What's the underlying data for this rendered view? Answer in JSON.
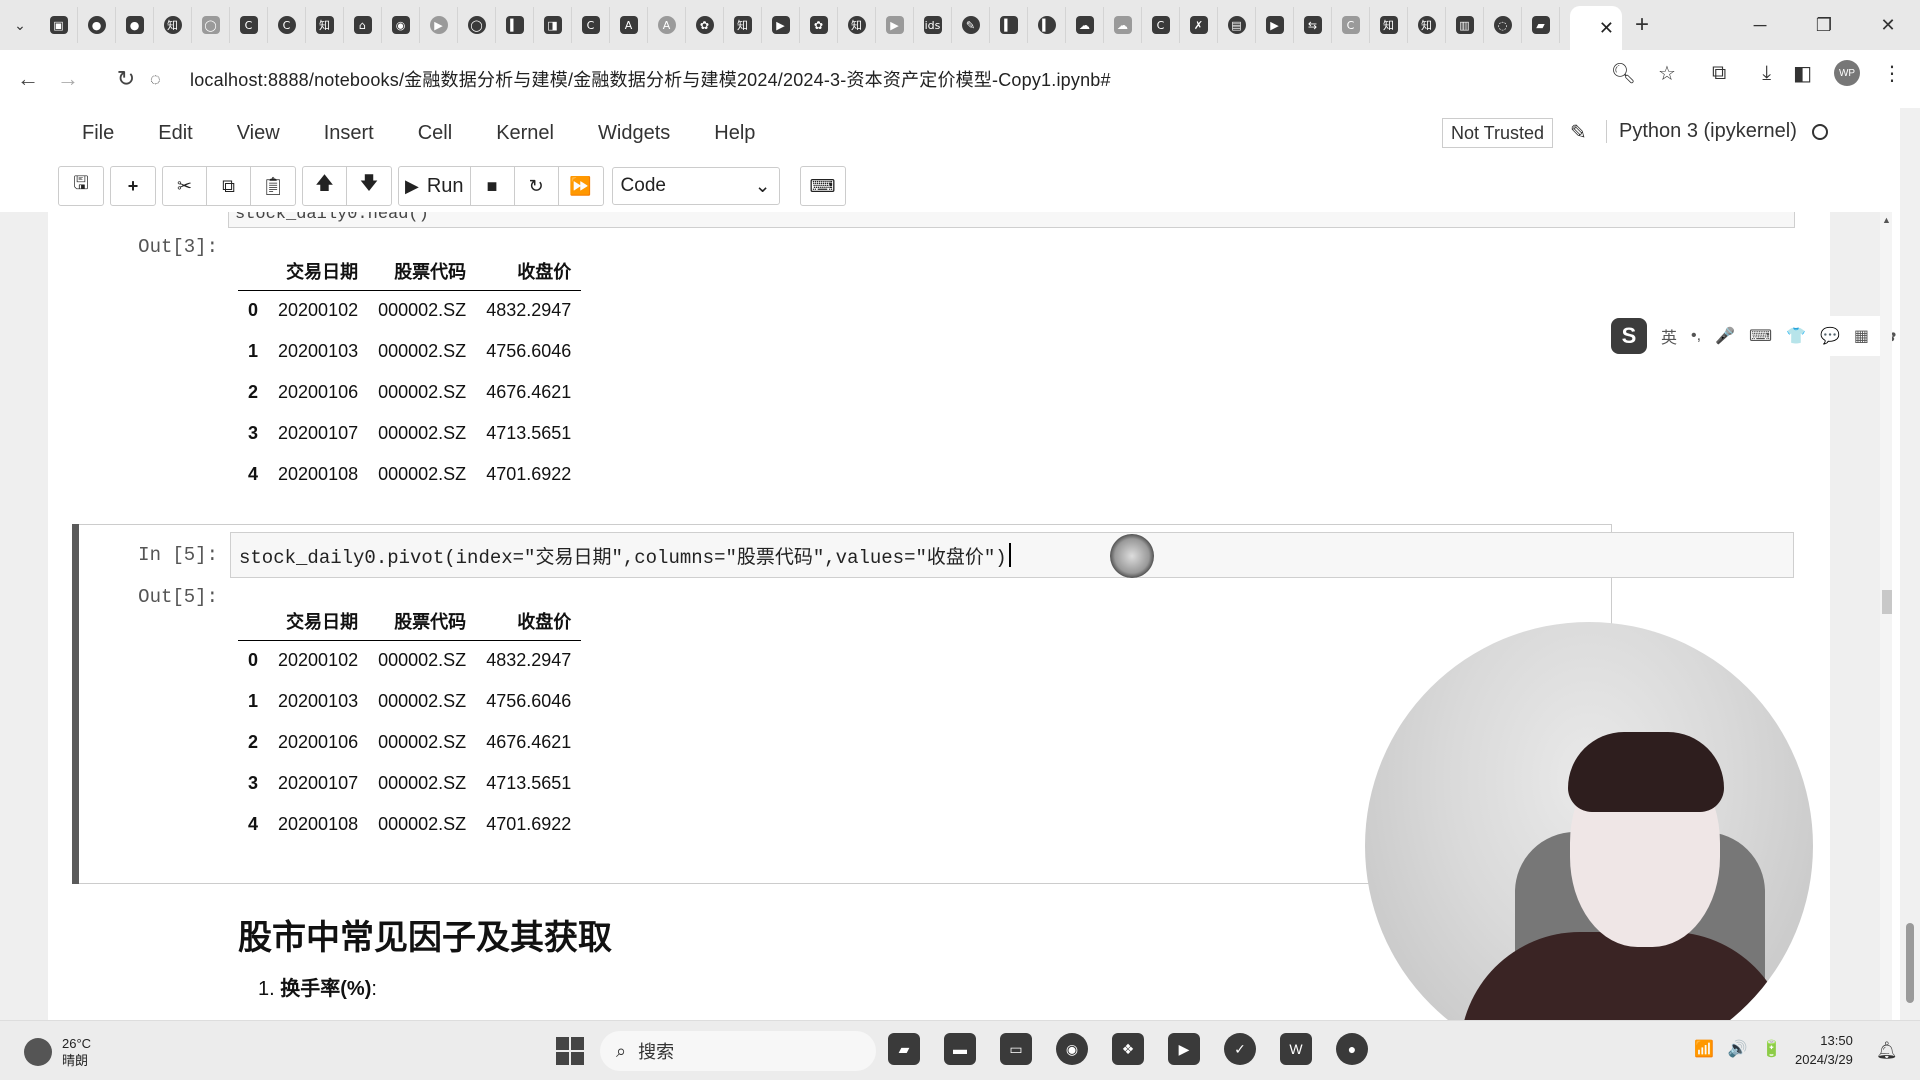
{
  "browser": {
    "tab_favicons": [
      "▣",
      "●",
      "●",
      "知",
      "◯",
      "C",
      "C",
      "知",
      "⌂",
      "◉",
      "▶",
      "◯",
      "▍",
      "◨",
      "C",
      "A",
      "A",
      "✿",
      "知",
      "▶",
      "✿",
      "知",
      "▶",
      "ids",
      "✎",
      "▍",
      "▍",
      "☁",
      "☁",
      "C",
      "✗",
      "▤",
      "▶",
      "⇆",
      "C",
      "知",
      "知",
      "▥",
      "◌",
      "▰"
    ],
    "active_tab_close": "✕",
    "new_tab": "+",
    "window_controls": [
      "─",
      "❐",
      "✕"
    ],
    "url": "localhost:8888/notebooks/金融数据分析与建模/金融数据分析与建模2024/2024-3-资本资产定价模型-Copy1.ipynb#"
  },
  "jupyter": {
    "menu": [
      "File",
      "Edit",
      "View",
      "Insert",
      "Cell",
      "Kernel",
      "Widgets",
      "Help"
    ],
    "trusted": "Not Trusted",
    "kernel": "Python 3 (ipykernel)",
    "toolbar": {
      "run_label": "Run",
      "cell_type": "Code"
    }
  },
  "notebook": {
    "prev_input_fragment": "stock_daily0.head()",
    "out3_prompt": "Out[3]:",
    "in5_prompt": "In  [5]:",
    "out5_prompt": "Out[5]:",
    "code_in5": "stock_daily0.pivot(index=\"交易日期\",columns=\"股票代码\",values=\"收盘价\")",
    "table_columns": [
      "",
      "交易日期",
      "股票代码",
      "收盘价"
    ],
    "out3_rows": [
      [
        "0",
        "20200102",
        "000002.SZ",
        "4832.2947"
      ],
      [
        "1",
        "20200103",
        "000002.SZ",
        "4756.6046"
      ],
      [
        "2",
        "20200106",
        "000002.SZ",
        "4676.4621"
      ],
      [
        "3",
        "20200107",
        "000002.SZ",
        "4713.5651"
      ],
      [
        "4",
        "20200108",
        "000002.SZ",
        "4701.6922"
      ]
    ],
    "out5_rows": [
      [
        "0",
        "20200102",
        "000002.SZ",
        "4832.2947"
      ],
      [
        "1",
        "20200103",
        "000002.SZ",
        "4756.6046"
      ],
      [
        "2",
        "20200106",
        "000002.SZ",
        "4676.4621"
      ],
      [
        "3",
        "20200107",
        "000002.SZ",
        "4713.5651"
      ],
      [
        "4",
        "20200108",
        "000002.SZ",
        "4701.6922"
      ]
    ],
    "md_heading": "股市中常见因子及其获取",
    "md_item_num": "1.",
    "md_item": "换手率(%)",
    "md_item_colon": ":"
  },
  "ime": {
    "logo": "S",
    "lang": "英",
    "icons": [
      "•,",
      "🎤",
      "⌨",
      "👕",
      "💬",
      "▦",
      "✿"
    ]
  },
  "taskbar": {
    "temp": "26°C",
    "weather": "晴朗",
    "search_placeholder": "搜索",
    "apps": [
      "▰",
      "▬",
      "▭",
      "◉",
      "❖",
      "▶",
      "✓",
      "W",
      "●"
    ],
    "tray": [
      "📶",
      "🔊",
      "🔋"
    ],
    "time": "13:50",
    "date": "2024/3/29"
  }
}
